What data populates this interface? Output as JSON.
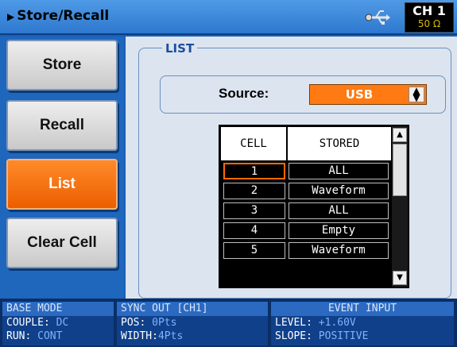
{
  "title": "Store/Recall",
  "channel": {
    "name": "CH 1",
    "load": "50 Ω"
  },
  "icons": {
    "title_arrow": "triangle-right-icon",
    "usb": "usb-icon",
    "spin": "up-down-spinner-icon"
  },
  "colors": {
    "active": "#ff7a12",
    "background": "#1a5fb4"
  },
  "sidebar": {
    "buttons": [
      {
        "label": "Store",
        "active": false
      },
      {
        "label": "Recall",
        "active": false
      },
      {
        "label": "List",
        "active": true
      },
      {
        "label": "Clear Cell",
        "active": false
      }
    ]
  },
  "list": {
    "group_title": "LIST",
    "source_label": "Source:",
    "source_value": "USB",
    "columns": [
      "CELL",
      "STORED"
    ],
    "rows": [
      {
        "cell": "1",
        "stored": "ALL"
      },
      {
        "cell": "2",
        "stored": "Waveform"
      },
      {
        "cell": "3",
        "stored": "ALL"
      },
      {
        "cell": "4",
        "stored": "Empty"
      },
      {
        "cell": "5",
        "stored": "Waveform"
      }
    ],
    "selected_row": 0
  },
  "status": {
    "base_mode": {
      "header": "BASE MODE",
      "couple_label": "COUPLE:",
      "couple": "DC",
      "run_label": "RUN:",
      "run": "CONT"
    },
    "sync_out": {
      "header": "SYNC OUT [CH1]",
      "pos_label": "POS:",
      "pos": "0Pts",
      "width_label": "WIDTH:",
      "width": "4Pts"
    },
    "event_input": {
      "header": "EVENT INPUT",
      "level_label": "LEVEL:",
      "level": "+1.60V",
      "slope_label": "SLOPE:",
      "slope": "POSITIVE"
    }
  }
}
